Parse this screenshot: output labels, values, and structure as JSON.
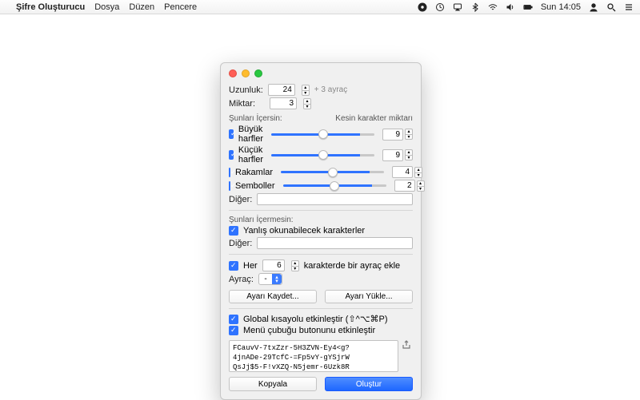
{
  "menubar": {
    "app": "Şifre Oluşturucu",
    "items": [
      "Dosya",
      "Düzen",
      "Pencere"
    ],
    "clock": "Sun 14:05"
  },
  "length": {
    "label": "Uzunluk:",
    "value": "24",
    "suffix": "+ 3 ayraç"
  },
  "amount": {
    "label": "Miktar:",
    "value": "3"
  },
  "include": {
    "header": "Şunları İçersin:",
    "exact": "Kesin karakter miktarı",
    "rows": [
      {
        "label": "Büyük harfler",
        "value": "9",
        "fill": "86%"
      },
      {
        "label": "Küçük harfler",
        "value": "9",
        "fill": "86%"
      },
      {
        "label": "Rakamlar",
        "value": "4",
        "fill": "86%"
      },
      {
        "label": "Semboller",
        "value": "2",
        "fill": "86%"
      }
    ],
    "other_label": "Diğer:"
  },
  "exclude": {
    "header": "Şunları İçermesin:",
    "ambiguous": "Yanlış okunabilecek karakterler",
    "other_label": "Diğer:"
  },
  "separator": {
    "every_label": "Her",
    "every_value": "6",
    "every_suffix": "karakterde bir ayraç ekle",
    "sep_label": "Ayraç:",
    "sep_value": "-"
  },
  "presets": {
    "save": "Ayarı Kaydet...",
    "load": "Ayarı Yükle..."
  },
  "options": {
    "shortcut": "Global kısayolu etkinleştir (⇧^⌥⌘P)",
    "menuicon": "Menü çubuğu butonunu etkinleştir"
  },
  "output": "FCauvV-7txZzr-5H3ZVN-Ey4<g?\n4jnADe-29TcfC-=Fp5vY-gYSjrW\nQsJj$5-F!vXZQ-N5jemr-6Uzk8R",
  "actions": {
    "copy": "Kopyala",
    "generate": "Oluştur"
  }
}
